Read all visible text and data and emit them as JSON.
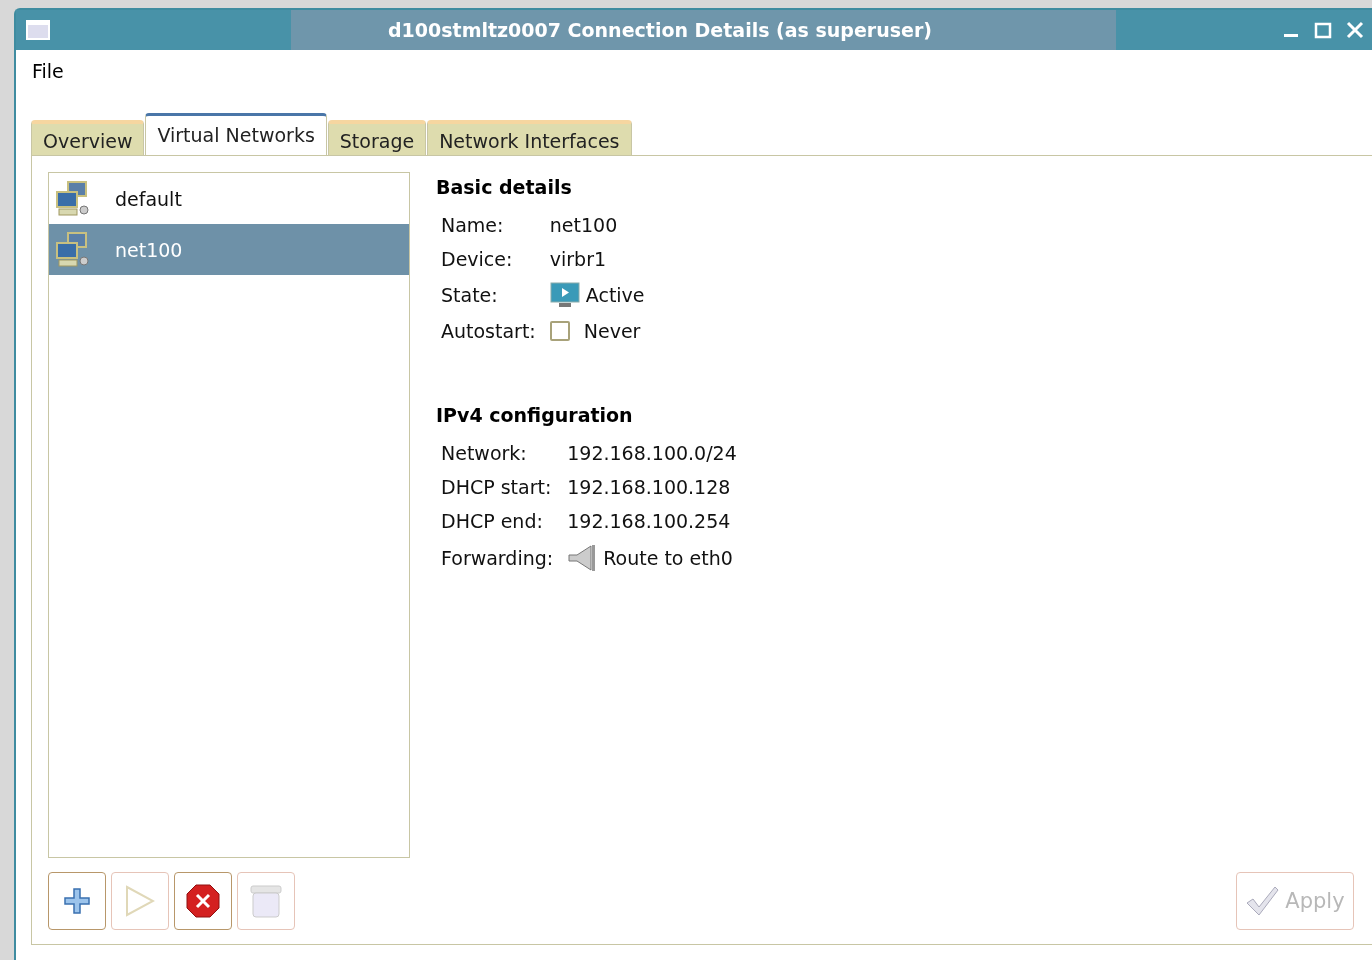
{
  "window": {
    "title": "d100stmltz0007 Connection Details (as superuser)"
  },
  "menu": [
    "File"
  ],
  "tabs": [
    {
      "label": "Overview",
      "selected": false
    },
    {
      "label": "Virtual Networks",
      "selected": true
    },
    {
      "label": "Storage",
      "selected": false
    },
    {
      "label": "Network Interfaces",
      "selected": false
    }
  ],
  "networks": [
    {
      "name": "default",
      "selected": false
    },
    {
      "name": "net100",
      "selected": true
    }
  ],
  "basic_details": {
    "heading": "Basic details",
    "rows": [
      {
        "kind": "text",
        "label": "Name:",
        "value": "net100"
      },
      {
        "kind": "text",
        "label": "Device:",
        "value": "virbr1"
      },
      {
        "kind": "state",
        "label": "State:",
        "value": "Active"
      },
      {
        "kind": "checkbox",
        "label": "Autostart:",
        "value": "Never",
        "checked": false
      }
    ]
  },
  "ipv4": {
    "heading": "IPv4 configuration",
    "rows": [
      {
        "kind": "text",
        "label": "Network:",
        "value": "192.168.100.0/24"
      },
      {
        "kind": "text",
        "label": "DHCP start:",
        "value": "192.168.100.128"
      },
      {
        "kind": "text",
        "label": "DHCP end:",
        "value": "192.168.100.254"
      },
      {
        "kind": "forward",
        "label": "Forwarding:",
        "value": "Route to eth0"
      }
    ]
  },
  "toolbar": [
    {
      "kind": "add",
      "disabled": false
    },
    {
      "kind": "start",
      "disabled": true
    },
    {
      "kind": "stop",
      "disabled": false
    },
    {
      "kind": "delete",
      "disabled": true
    }
  ],
  "apply": {
    "label": "Apply",
    "disabled": true
  }
}
